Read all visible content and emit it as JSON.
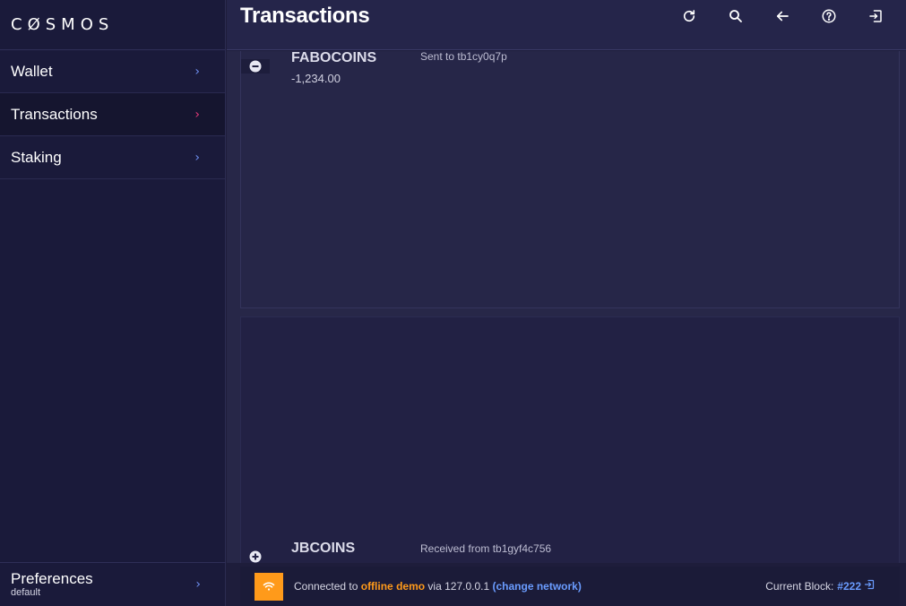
{
  "app": {
    "logo": "CØSMOS"
  },
  "sidebar": {
    "items": [
      {
        "label": "Wallet"
      },
      {
        "label": "Transactions"
      },
      {
        "label": "Staking"
      }
    ],
    "preferences": {
      "title": "Preferences",
      "subtitle": "default"
    }
  },
  "header": {
    "title": "Transactions",
    "actions": [
      "refresh-icon",
      "search-icon",
      "back-arrow-icon",
      "help-icon",
      "sign-out-icon"
    ]
  },
  "transactions": [
    {
      "type": "sent",
      "coin": "FABOCOINS",
      "amount": "-1,234.00",
      "description": "Sent to tb1cy0q7p",
      "icon": "minus-circle-icon"
    },
    {
      "type": "received",
      "coin": "JBCOINS",
      "description": "Received from tb1gyf4c756",
      "icon": "plus-circle-icon"
    }
  ],
  "status": {
    "prefix": "Connected to",
    "network": "offline demo",
    "via": "via 127.0.0.1",
    "change_label": "(change network)",
    "block_label": "Current Block:",
    "block_number": "#222"
  },
  "colors": {
    "accent_orange": "#ff9a1a",
    "link_blue": "#6a9cff",
    "active_chevron": "#e33a7a",
    "chevron": "#6e8ff0"
  }
}
